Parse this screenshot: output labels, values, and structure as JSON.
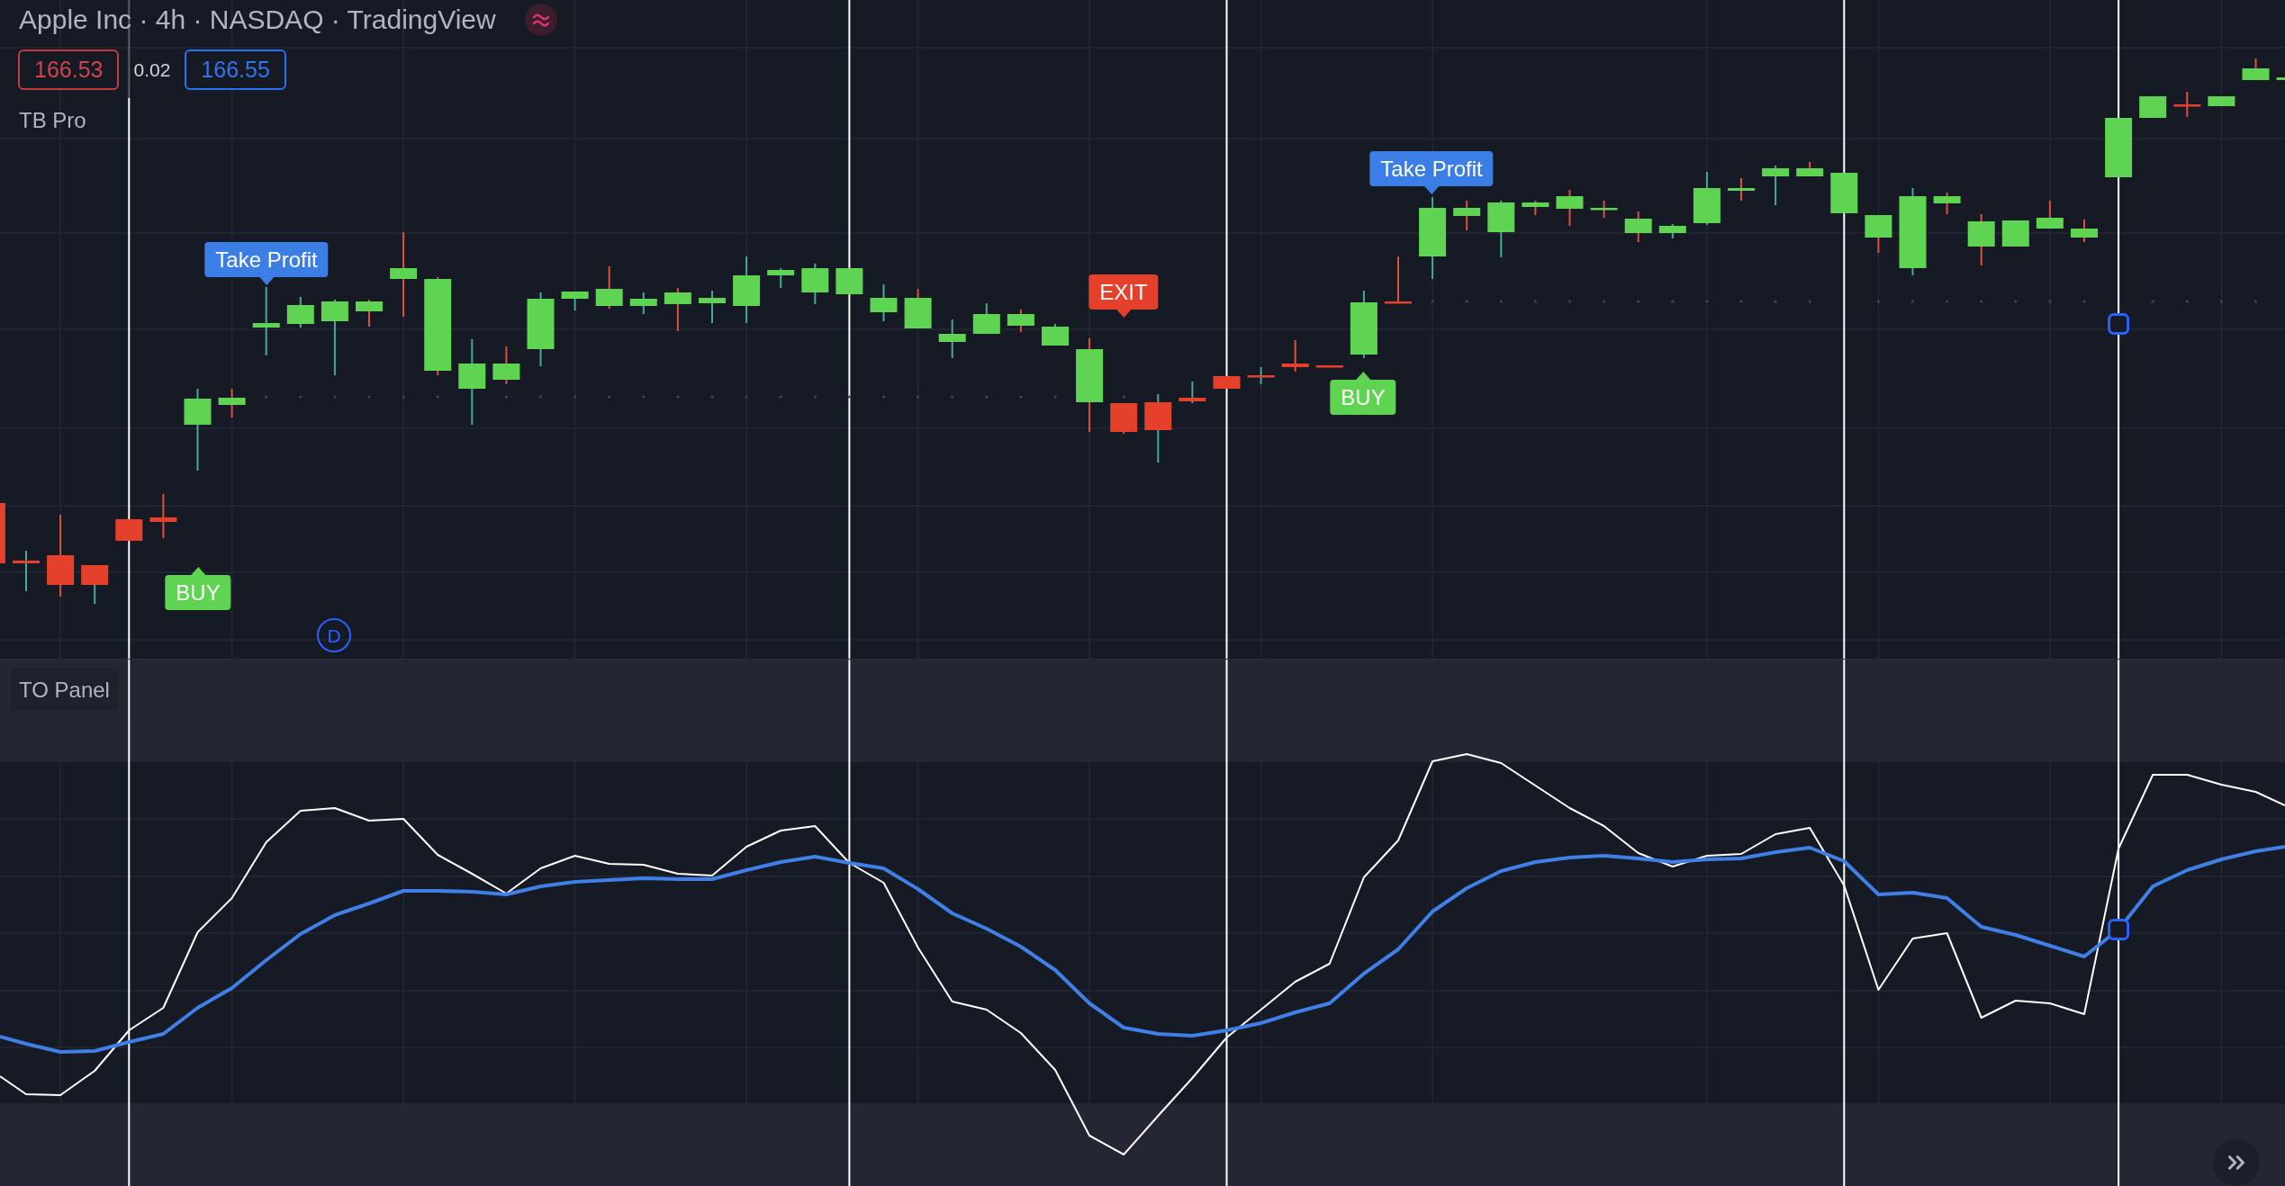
{
  "legend": {
    "title": "Apple Inc · 4h · NASDAQ · TradingView",
    "bid": "166.53",
    "spread": "0.02",
    "ask": "166.55",
    "indicator": "TB Pro"
  },
  "price_pane": {
    "signals": [
      {
        "kind": "buy",
        "text": "BUY",
        "color": "#5fd452"
      },
      {
        "kind": "take_profit",
        "text": "Take Profit",
        "color": "#3a7ee6"
      },
      {
        "kind": "exit",
        "text": "EXIT",
        "color": "#e5402c"
      },
      {
        "kind": "buy",
        "text": "BUY",
        "color": "#5fd452"
      },
      {
        "kind": "take_profit",
        "text": "Take Profit",
        "color": "#3a7ee6"
      }
    ],
    "event_marker": "D"
  },
  "oscillator_pane": {
    "title": "TO Panel"
  }
}
